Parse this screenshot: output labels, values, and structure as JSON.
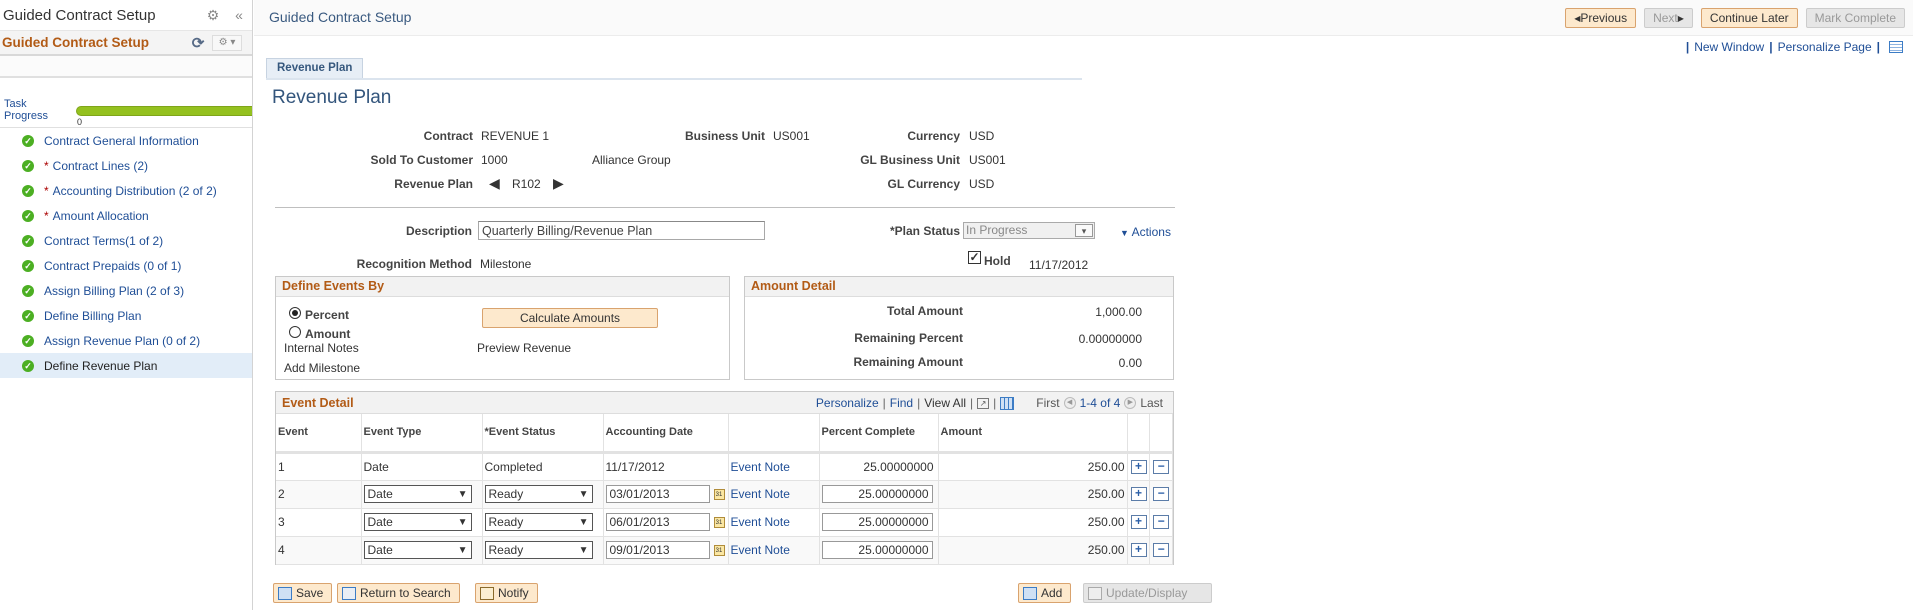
{
  "sidebar": {
    "app_title": "Guided Contract Setup",
    "section_title": "Guided Contract Setup",
    "progress_label": "Task Progress",
    "progress_value": "0",
    "progress_fraction": 1.0,
    "steps": [
      {
        "label": "Contract General Information",
        "required": false,
        "complete": true,
        "active": false
      },
      {
        "label": "Contract Lines (2)",
        "required": true,
        "complete": true,
        "active": false
      },
      {
        "label": "Accounting Distribution (2 of 2)",
        "required": true,
        "complete": true,
        "active": false
      },
      {
        "label": "Amount Allocation",
        "required": true,
        "complete": true,
        "active": false
      },
      {
        "label": "Contract Terms(1 of 2)",
        "required": false,
        "complete": true,
        "active": false
      },
      {
        "label": "Contract Prepaids (0 of 1)",
        "required": false,
        "complete": true,
        "active": false
      },
      {
        "label": "Assign Billing Plan (2 of 3)",
        "required": false,
        "complete": true,
        "active": false
      },
      {
        "label": "Define Billing Plan",
        "required": false,
        "complete": true,
        "active": false
      },
      {
        "label": "Assign Revenue Plan (0 of 2)",
        "required": false,
        "complete": true,
        "active": false
      },
      {
        "label": "Define Revenue Plan",
        "required": false,
        "complete": true,
        "active": true
      }
    ]
  },
  "header": {
    "title": "Guided Contract Setup",
    "previous": "Previous",
    "next": "Next",
    "continue_later": "Continue Later",
    "mark_complete": "Mark Complete",
    "new_window": "New Window",
    "personalize_page": "Personalize Page"
  },
  "tab": {
    "label": "Revenue Plan"
  },
  "page_title": "Revenue Plan",
  "fields": {
    "contract_label": "Contract",
    "contract": "REVENUE 1",
    "bu_label": "Business Unit",
    "bu": "US001",
    "currency_label": "Currency",
    "currency": "USD",
    "customer_label": "Sold To Customer",
    "customer_id": "1000",
    "customer_name": "Alliance Group",
    "gl_bu_label": "GL Business Unit",
    "gl_bu": "US001",
    "plan_label": "Revenue Plan",
    "plan": "R102",
    "gl_currency_label": "GL Currency",
    "gl_currency": "USD",
    "description_label": "Description",
    "description": "Quarterly Billing/Revenue Plan",
    "plan_status_label": "*Plan Status",
    "plan_status": "In Progress",
    "actions": "Actions",
    "recog_label": "Recognition Method",
    "recog": "Milestone",
    "hold_label": "Hold",
    "hold_checked": true,
    "hold_date": "11/17/2012"
  },
  "define_events": {
    "title": "Define Events By",
    "percent": "Percent",
    "amount": "Amount",
    "selected": "Percent",
    "calculate": "Calculate Amounts",
    "internal_notes": "Internal Notes",
    "preview_revenue": "Preview Revenue",
    "add_milestone": "Add Milestone"
  },
  "amount_detail": {
    "title": "Amount Detail",
    "total_label": "Total Amount",
    "total": "1,000.00",
    "rem_pct_label": "Remaining Percent",
    "rem_pct": "0.00000000",
    "rem_amt_label": "Remaining Amount",
    "rem_amt": "0.00"
  },
  "event_detail": {
    "title": "Event Detail",
    "personalize": "Personalize",
    "find": "Find",
    "view_all": "View All",
    "first": "First",
    "range": "1-4 of 4",
    "last": "Last",
    "columns": [
      "Event",
      "Event Type",
      "*Event Status",
      "Accounting Date",
      "",
      "Percent Complete",
      "Amount"
    ],
    "rows": [
      {
        "event": "1",
        "type": "Date",
        "status": "Completed",
        "date": "11/17/2012",
        "note": "Event Note",
        "pct": "25.00000000",
        "amount": "250.00",
        "editable": false
      },
      {
        "event": "2",
        "type": "Date",
        "status": "Ready",
        "date": "03/01/2013",
        "note": "Event Note",
        "pct": "25.00000000",
        "amount": "250.00",
        "editable": true
      },
      {
        "event": "3",
        "type": "Date",
        "status": "Ready",
        "date": "06/01/2013",
        "note": "Event Note",
        "pct": "25.00000000",
        "amount": "250.00",
        "editable": true
      },
      {
        "event": "4",
        "type": "Date",
        "status": "Ready",
        "date": "09/01/2013",
        "note": "Event Note",
        "pct": "25.00000000",
        "amount": "250.00",
        "editable": true
      }
    ]
  },
  "footer": {
    "save": "Save",
    "return": "Return to Search",
    "notify": "Notify",
    "add": "Add",
    "update": "Update/Display"
  }
}
